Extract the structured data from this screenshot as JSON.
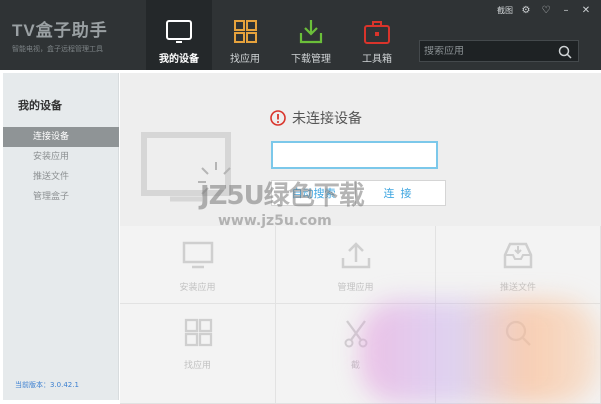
{
  "app": {
    "title": "TV盒子助手",
    "subtitle": "智能电视，盒子远程管理工具"
  },
  "nav": [
    {
      "label": "我的设备",
      "icon": "tv-icon"
    },
    {
      "label": "找应用",
      "icon": "grid-apps-icon"
    },
    {
      "label": "下载管理",
      "icon": "download-icon"
    },
    {
      "label": "工具箱",
      "icon": "toolbox-icon"
    }
  ],
  "search": {
    "placeholder": "搜索应用"
  },
  "window": {
    "skin_label": "截图"
  },
  "sidebar": {
    "title": "我的设备",
    "items": [
      {
        "label": "连接设备",
        "active": true
      },
      {
        "label": "安装应用",
        "active": false
      },
      {
        "label": "推送文件",
        "active": false
      },
      {
        "label": "管理盒子",
        "active": false
      }
    ],
    "version": "当前版本：3.0.42.1"
  },
  "main": {
    "status": "未连接设备",
    "input_value": "",
    "auto_search_label": "自动搜索",
    "connect_label": "连接",
    "tiles": [
      {
        "label": "安装应用",
        "icon": "monitor-icon"
      },
      {
        "label": "管理应用",
        "icon": "upload-icon"
      },
      {
        "label": "推送文件",
        "icon": "inbox-icon"
      },
      {
        "label": "找应用",
        "icon": "grid-apps-icon"
      },
      {
        "label": "截",
        "icon": "scissors-icon"
      },
      {
        "label": "",
        "icon": "search-icon"
      }
    ]
  },
  "watermark": {
    "text": "JZ5U绿色下载",
    "url": "www.jz5u.com"
  },
  "colors": {
    "topbar": "#2f3335",
    "accent_blue": "#3fa6e0",
    "warn_red": "#d9342b",
    "download_green": "#6bbf3a",
    "apps_orange": "#e6a23c",
    "toolbox_red": "#d9342b"
  }
}
